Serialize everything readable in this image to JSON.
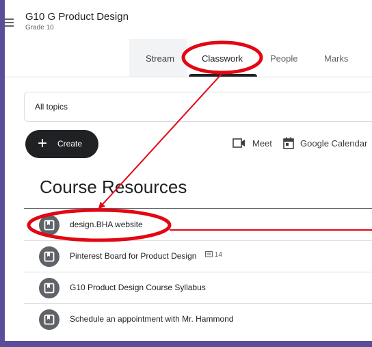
{
  "header": {
    "menu_icon": "hamburger-menu-icon",
    "class_title": "G10 G Product Design",
    "class_subtitle": "Grade 10"
  },
  "tabs": [
    {
      "label": "Stream"
    },
    {
      "label": "Classwork",
      "active": true
    },
    {
      "label": "People"
    },
    {
      "label": "Marks"
    }
  ],
  "filter": {
    "selected": "All topics"
  },
  "toolbar": {
    "create_label": "Create",
    "meet_label": "Meet",
    "calendar_label": "Google Calendar"
  },
  "section": {
    "title": "Course Resources"
  },
  "materials": [
    {
      "title": "design.BHA website",
      "icon": "material-icon"
    },
    {
      "title": "Pinterest Board for Product Design",
      "icon": "material-icon",
      "comments": "14"
    },
    {
      "title": "G10 Product Design Course Syllabus",
      "icon": "material-icon"
    },
    {
      "title": "Schedule an appointment with Mr. Hammond",
      "icon": "material-icon"
    }
  ],
  "annotation_color": "#e30613",
  "colors": {
    "frame_background": "#5b4d9a",
    "text_primary": "#202124",
    "icon_gray": "#5f6368"
  }
}
